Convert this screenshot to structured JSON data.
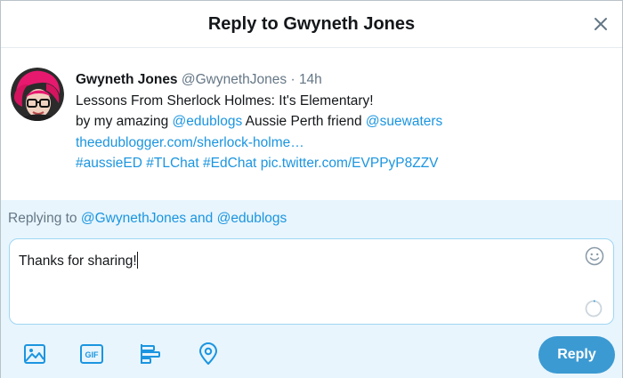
{
  "dialog": {
    "title": "Reply to Gwyneth Jones",
    "close_icon": "close-icon"
  },
  "tweet": {
    "author_name": "Gwyneth Jones",
    "author_handle": "@GwynethJones",
    "separator": "·",
    "time": "14h",
    "line1": "Lessons From Sherlock Holmes: It's Elementary!",
    "line2_prefix": "by my amazing ",
    "mention1": "@edublogs",
    "line2_middle": " Aussie Perth friend ",
    "mention2": "@suewaters",
    "url": "theedublogger.com/sherlock-holme…",
    "hashtag1": "#aussieED",
    "hashtag2": "#TLChat",
    "hashtag3": "#EdChat",
    "pic_link": "pic.twitter.com/EVPPyP8ZZV"
  },
  "reply": {
    "replying_prefix": "Replying to ",
    "replying_users": "@GwynethJones and @edublogs",
    "text": "Thanks for sharing!",
    "button_label": "Reply"
  },
  "icons": {
    "emoji": "emoji-icon",
    "media": "image-icon",
    "gif": "GIF",
    "poll": "poll-icon",
    "location": "location-icon"
  },
  "colors": {
    "accent": "#1b95e0",
    "reply_button": "#3c9ad2",
    "reply_area_bg": "#e8f5fd"
  }
}
